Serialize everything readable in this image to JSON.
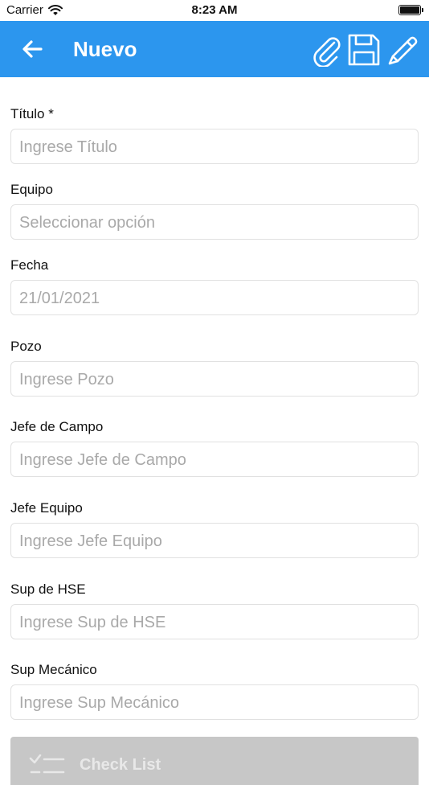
{
  "status_bar": {
    "carrier": "Carrier",
    "time": "8:23 AM"
  },
  "header": {
    "title": "Nuevo",
    "accent_color": "#2c96ee"
  },
  "form": {
    "fields": [
      {
        "label": "Título *",
        "placeholder": "Ingrese Título"
      },
      {
        "label": "Equipo",
        "placeholder": "Seleccionar opción"
      },
      {
        "label": "Fecha",
        "value": "21/01/2021"
      },
      {
        "label": "Pozo",
        "placeholder": "Ingrese Pozo"
      },
      {
        "label": "Jefe de Campo",
        "placeholder": "Ingrese Jefe de Campo"
      },
      {
        "label": "Jefe Equipo",
        "placeholder": "Ingrese Jefe Equipo"
      },
      {
        "label": "Sup de HSE",
        "placeholder": "Ingrese Sup de HSE"
      },
      {
        "label": "Sup Mecánico",
        "placeholder": "Ingrese Sup Mecánico"
      }
    ]
  },
  "bottom_button": {
    "label": "Check List"
  }
}
